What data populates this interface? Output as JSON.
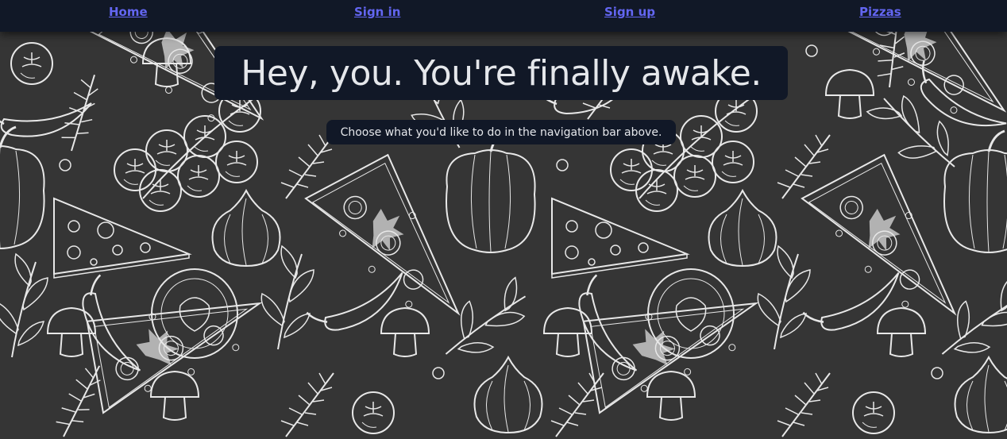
{
  "nav": {
    "home": "Home",
    "signin": "Sign in",
    "signup": "Sign up",
    "pizzas": "Pizzas"
  },
  "hero": {
    "title": "Hey, you. You're finally awake.",
    "subtitle": "Choose what you'd like to do in the navigation bar above."
  },
  "colors": {
    "navbar_bg": "#111827",
    "link": "#6366f1",
    "panel_bg": "#111827",
    "text": "#e5e7eb",
    "background": "#353535",
    "sketch_lines": "#e8e8e8"
  },
  "background": {
    "description_icons": [
      "tomato-icon",
      "pizza-slice-icon",
      "cheese-icon",
      "garlic-icon",
      "pepper-icon",
      "mushroom-icon",
      "herb-icon",
      "chili-icon",
      "olive-icon"
    ]
  }
}
